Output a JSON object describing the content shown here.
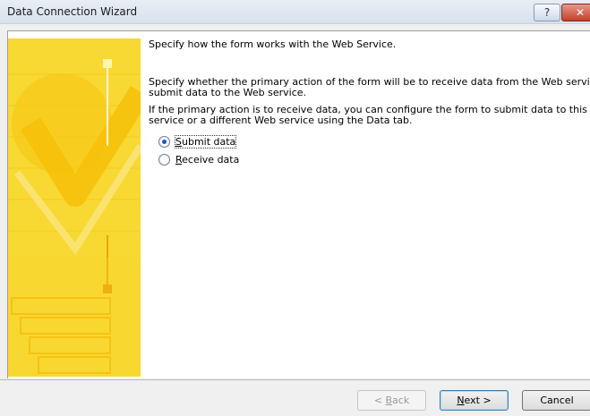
{
  "window": {
    "title": "Data Connection Wizard",
    "help_glyph": "?",
    "close_glyph": "✕"
  },
  "main": {
    "intro": "Specify how the form works with the Web Service.",
    "paragraph1_line1": "Specify whether the primary action of the form will be to receive data from the Web service or",
    "paragraph1_line2": "submit data to the Web service.",
    "paragraph2_line1": "If the primary action is to receive data, you can configure the form to submit data to this Web",
    "paragraph2_line2": "service or a different Web service using the Data tab.",
    "options": [
      {
        "access_key": "S",
        "rest": "ubmit data",
        "selected": true
      },
      {
        "access_key": "R",
        "rest": "eceive data",
        "selected": false
      }
    ]
  },
  "buttons": {
    "back_prefix": "< ",
    "back_key": "B",
    "back_rest": "ack",
    "next_key": "N",
    "next_rest": "ext >",
    "cancel": "Cancel"
  },
  "colors": {
    "sidebar_yellow": "#f7d320",
    "accent_blue": "#1d56c8"
  }
}
